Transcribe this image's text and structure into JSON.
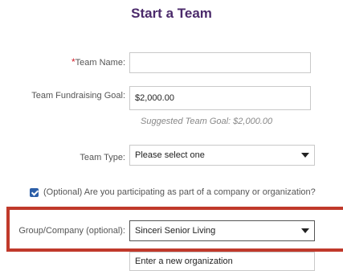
{
  "header": {
    "title": "Start a Team"
  },
  "form": {
    "required_marker": "*",
    "team_name_label": "Team Name:",
    "team_name_value": "",
    "goal_label": "Team Fundraising Goal:",
    "goal_value": "$2,000.00",
    "goal_hint": "Suggested Team Goal: $2,000.00",
    "team_type_label": "Team Type:",
    "team_type_value": "Please select one",
    "org_checkbox_checked": true,
    "org_checkbox_label": "(Optional) Are you participating as part of a company or organization?",
    "group_label": "Group/Company (optional):",
    "group_value": "Sinceri Senior Living",
    "new_org_value": "Enter a new organization"
  },
  "colors": {
    "title": "#4b2a6b",
    "required": "#d21e2b",
    "highlight_border": "#c0392b",
    "checkbox": "#2d5fa8"
  },
  "icons": {
    "dropdown": "triangle-down",
    "checkbox": "checkmark"
  }
}
